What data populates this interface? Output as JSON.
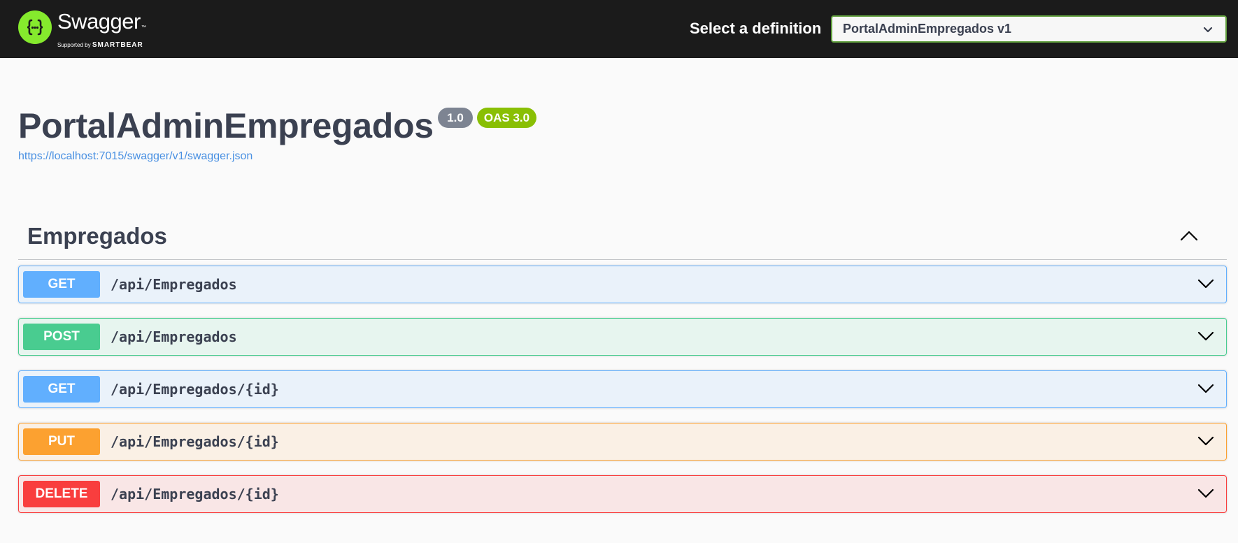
{
  "topbar": {
    "logo": {
      "name": "Swagger",
      "tm": "™",
      "supported_by": "Supported by",
      "company": "SMARTBEAR",
      "icon": "swagger-braces-icon",
      "color": "#85ea2d"
    },
    "definition_label": "Select a definition",
    "definition_selected": "PortalAdminEmpregados v1",
    "definition_chevron_icon": "chevron-down-icon"
  },
  "info": {
    "title": "PortalAdminEmpregados",
    "version": "1.0",
    "oas": "OAS 3.0",
    "spec_url": "https://localhost:7015/swagger/v1/swagger.json"
  },
  "tag": {
    "name": "Empregados",
    "chevron_icon": "chevron-up-icon",
    "operations": [
      {
        "method": "GET",
        "path": "/api/Empregados",
        "color": "#61affe"
      },
      {
        "method": "POST",
        "path": "/api/Empregados",
        "color": "#49cc90"
      },
      {
        "method": "GET",
        "path": "/api/Empregados/{id}",
        "color": "#61affe"
      },
      {
        "method": "PUT",
        "path": "/api/Empregados/{id}",
        "color": "#fca130"
      },
      {
        "method": "DELETE",
        "path": "/api/Empregados/{id}",
        "color": "#f93e3e"
      }
    ]
  }
}
